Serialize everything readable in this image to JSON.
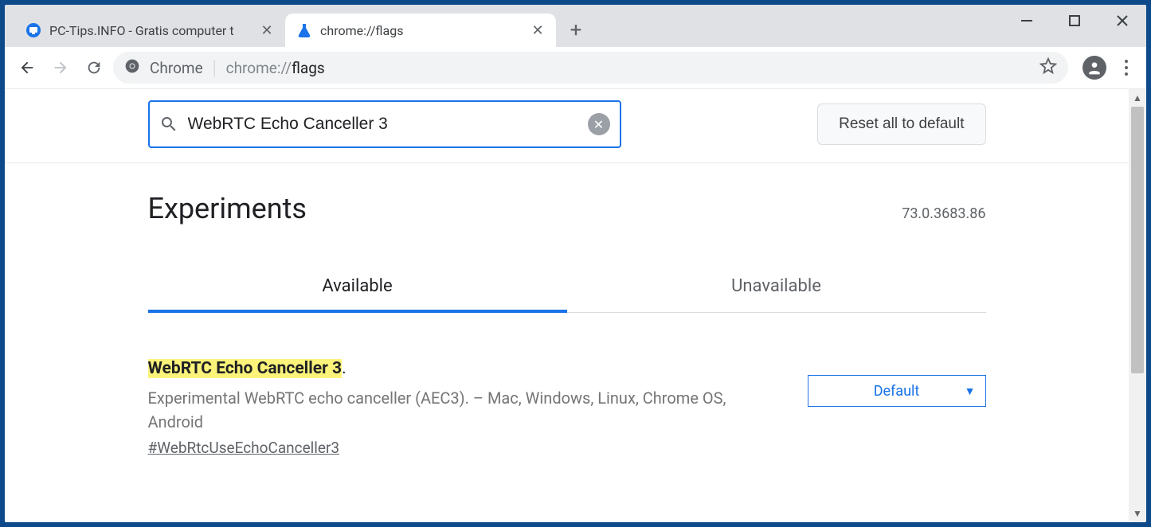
{
  "browser": {
    "tabs": [
      {
        "title": "PC-Tips.INFO - Gratis computer t",
        "active": false
      },
      {
        "title": "chrome://flags",
        "active": true
      }
    ],
    "omnibox": {
      "label": "Chrome",
      "url_prefix": "chrome://",
      "url_path": "flags"
    }
  },
  "flags": {
    "search_value": "WebRTC Echo Canceller 3",
    "reset_label": "Reset all to default",
    "heading": "Experiments",
    "version": "73.0.3683.86",
    "tabs": {
      "available": "Available",
      "unavailable": "Unavailable"
    },
    "item": {
      "title_highlight": "WebRTC Echo Canceller 3",
      "title_suffix": ".",
      "description": "Experimental WebRTC echo canceller (AEC3). – Mac, Windows, Linux, Chrome OS, Android",
      "hash": "#WebRtcUseEchoCanceller3",
      "selected": "Default"
    }
  }
}
